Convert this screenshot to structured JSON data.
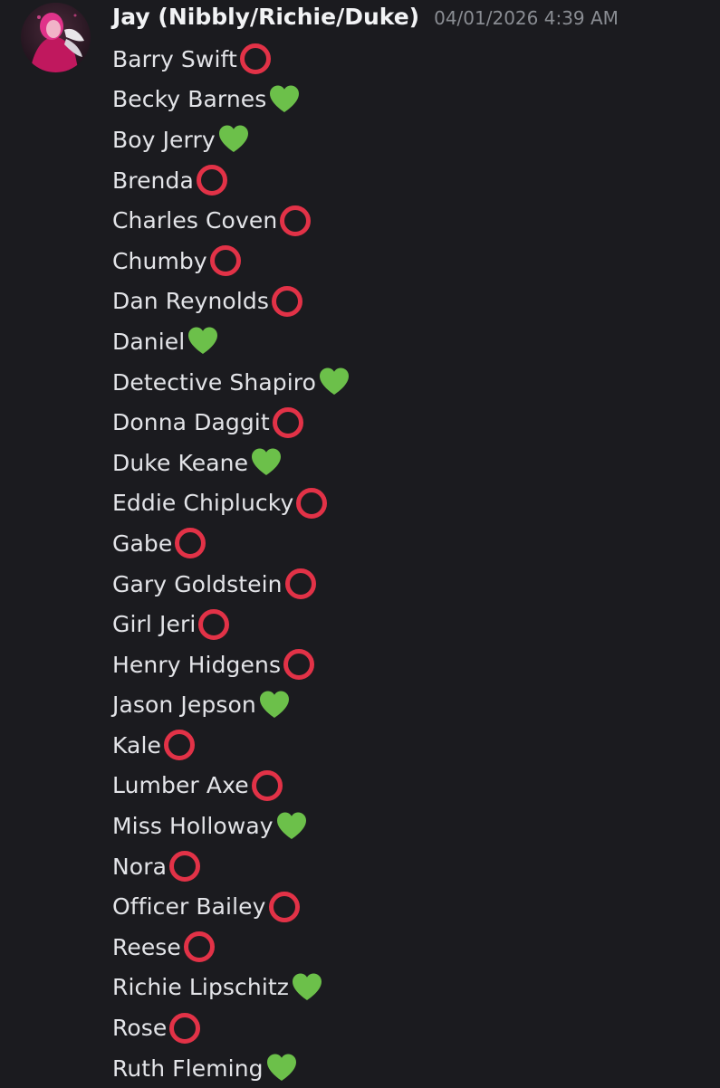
{
  "message": {
    "author": "Jay (Nibbly/Richie/Duke)",
    "timestamp": "04/01/2026 4:39 AM",
    "avatar_icon": "avatar-image",
    "colors": {
      "background": "#1b1b1f",
      "username": "#f2f3f5",
      "timestamp": "#8a8d93",
      "text": "#e3e4e8",
      "circle": "#e23247",
      "heart": "#6cc04a"
    },
    "lines": [
      {
        "name": "Barry Swift",
        "emoji": "hollow-red-circle-icon"
      },
      {
        "name": "Becky Barnes",
        "emoji": "green-heart-icon"
      },
      {
        "name": "Boy Jerry",
        "emoji": "green-heart-icon"
      },
      {
        "name": "Brenda",
        "emoji": "hollow-red-circle-icon"
      },
      {
        "name": "Charles Coven",
        "emoji": "hollow-red-circle-icon"
      },
      {
        "name": "Chumby",
        "emoji": "hollow-red-circle-icon"
      },
      {
        "name": "Dan Reynolds",
        "emoji": "hollow-red-circle-icon"
      },
      {
        "name": "Daniel",
        "emoji": "green-heart-icon"
      },
      {
        "name": "Detective Shapiro",
        "emoji": "green-heart-icon"
      },
      {
        "name": "Donna Daggit",
        "emoji": "hollow-red-circle-icon"
      },
      {
        "name": "Duke Keane",
        "emoji": "green-heart-icon"
      },
      {
        "name": "Eddie Chiplucky",
        "emoji": "hollow-red-circle-icon"
      },
      {
        "name": "Gabe",
        "emoji": "hollow-red-circle-icon"
      },
      {
        "name": "Gary Goldstein",
        "emoji": "hollow-red-circle-icon"
      },
      {
        "name": "Girl Jeri",
        "emoji": "hollow-red-circle-icon"
      },
      {
        "name": "Henry Hidgens",
        "emoji": "hollow-red-circle-icon"
      },
      {
        "name": "Jason Jepson",
        "emoji": "green-heart-icon"
      },
      {
        "name": "Kale",
        "emoji": "hollow-red-circle-icon"
      },
      {
        "name": "Lumber Axe",
        "emoji": "hollow-red-circle-icon"
      },
      {
        "name": "Miss Holloway",
        "emoji": "green-heart-icon"
      },
      {
        "name": "Nora",
        "emoji": "hollow-red-circle-icon"
      },
      {
        "name": "Officer Bailey",
        "emoji": "hollow-red-circle-icon"
      },
      {
        "name": "Reese",
        "emoji": "hollow-red-circle-icon"
      },
      {
        "name": "Richie Lipschitz",
        "emoji": "green-heart-icon"
      },
      {
        "name": "Rose",
        "emoji": "hollow-red-circle-icon"
      },
      {
        "name": "Ruth Fleming",
        "emoji": "green-heart-icon"
      }
    ]
  }
}
